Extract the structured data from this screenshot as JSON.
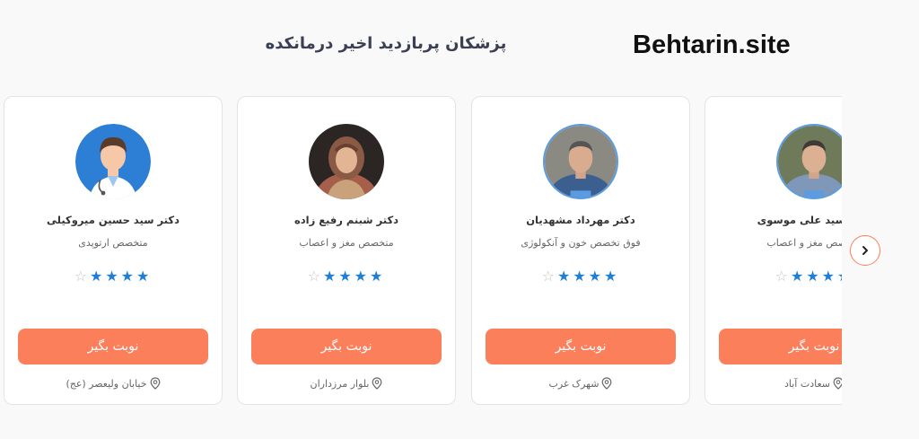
{
  "header": {
    "title": "پزشکان پربازدید اخیر درمانکده",
    "site_logo": "Behtarin.site"
  },
  "doctors": [
    {
      "name": "دکتر سید حسین میروکیلی",
      "specialty": "متخصص ارتوپدی",
      "rating": 4,
      "button": "نوبت بگیر",
      "location": "خیابان ولیعصر (عج)"
    },
    {
      "name": "دکتر شبنم رفیع زاده",
      "specialty": "متخصص مغز و اعصاب",
      "rating": 4,
      "button": "نوبت بگیر",
      "location": "بلوار مرزداران"
    },
    {
      "name": "دکتر مهرداد مشهدیان",
      "specialty": "فوق تخصص خون و آنکولوژی",
      "rating": 4,
      "button": "نوبت بگیر",
      "location": "شهرک غرب"
    },
    {
      "name": "دکتر سید علی موسوی",
      "specialty": "متخصص مغز و اعصاب",
      "rating": 4,
      "button": "نوبت بگیر",
      "location": "سعادت آباد"
    }
  ],
  "colors": {
    "accent": "#fc7f5c",
    "star": "#1d7fd6",
    "avatar_ring": "#5b9be0"
  },
  "icons": {
    "next": "chevron-right-icon",
    "location": "map-pin-icon",
    "star": "star-icon"
  }
}
